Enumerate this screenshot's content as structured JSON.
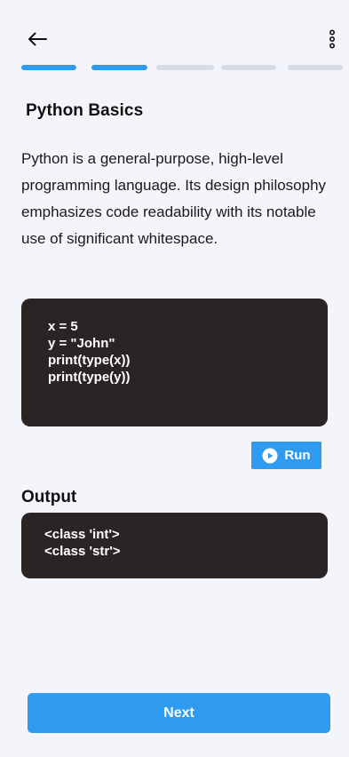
{
  "header": {
    "back_icon": "arrow-left-icon",
    "menu_icon": "more-vertical-icon"
  },
  "progress": {
    "total_steps": 5,
    "completed_steps": 2,
    "active_color": "#2F9BEF",
    "inactive_color": "#D7DCE6"
  },
  "lesson": {
    "title": "Python Basics",
    "description": "Python is a general-purpose, high-level programming language. Its design philosophy emphasizes code readability with its notable use of significant whitespace."
  },
  "code": {
    "lines": [
      "x = 5",
      "y = \"John\"",
      "print(type(x))",
      "print(type(y))"
    ]
  },
  "run_button": {
    "label": "Run",
    "icon": "play-circle-icon"
  },
  "output": {
    "title": "Output",
    "lines": [
      "<class 'int'>",
      "<class 'str'>"
    ]
  },
  "footer": {
    "next_label": "Next"
  },
  "colors": {
    "accent": "#2F9BEF",
    "code_bg": "#2B2424",
    "page_bg": "#F4F5FA"
  }
}
